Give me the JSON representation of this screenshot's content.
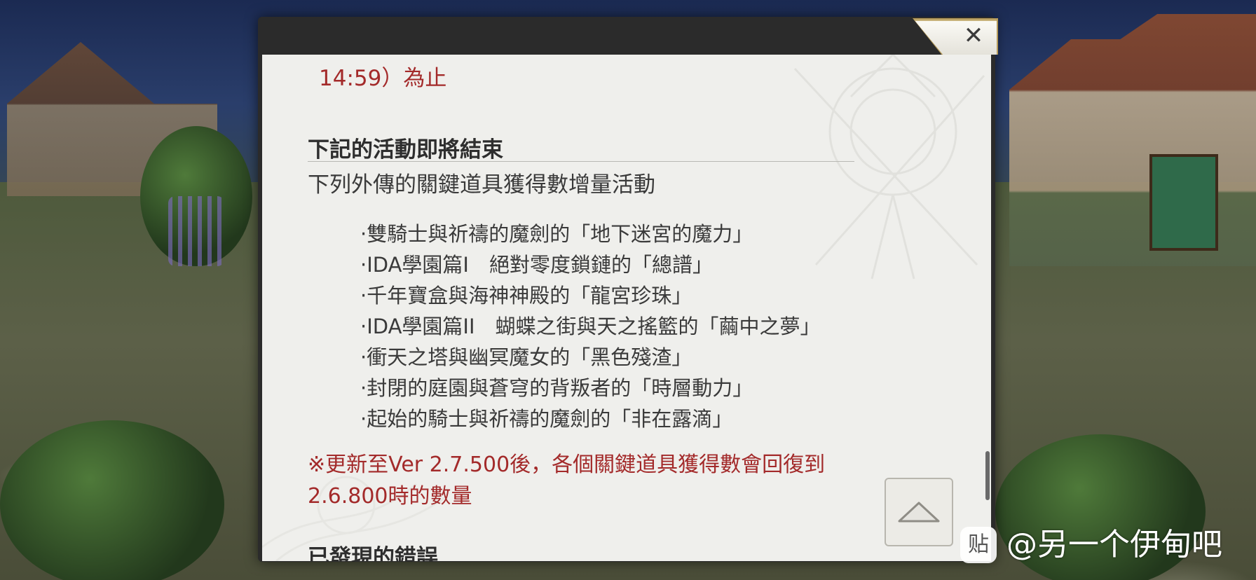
{
  "dialog": {
    "close_glyph": "✕",
    "fragment_time": "14:59）為止",
    "section_heading": "下記的活動即將結束",
    "section_subtitle": "下列外傳的關鍵道具獲得數增量活動",
    "event_items": [
      "·雙騎士與祈禱的魔劍的「地下迷宮的魔力」",
      "·IDA學園篇I　絕對零度鎖鏈的「總譜」",
      "·千年寶盒與海神神殿的「龍宮珍珠」",
      "·IDA學園篇II　蝴蝶之街與天之搖籃的「繭中之夢」",
      "·衝天之塔與幽冥魔女的「黑色殘渣」",
      "·封閉的庭園與蒼穹的背叛者的「時層動力」",
      "·起始的騎士與祈禱的魔劍的「非在露滴」"
    ],
    "notice_line1": "※更新至Ver 2.7.500後，各個關鍵道具獲得數會回復到",
    "notice_line2": "2.6.800時的數量",
    "next_section_heading": "已發現的錯誤",
    "scroll_top_icon": "chevron-up-icon",
    "colors": {
      "red_text": "#a32a2a",
      "body_text": "#3a3a3a",
      "panel_bg": "#efefec",
      "frame": "#2b2b2b",
      "close_tab_trim": "#b79c5c"
    }
  },
  "watermark": {
    "logo_glyph": "贴",
    "handle": "@另一个伊甸吧"
  }
}
